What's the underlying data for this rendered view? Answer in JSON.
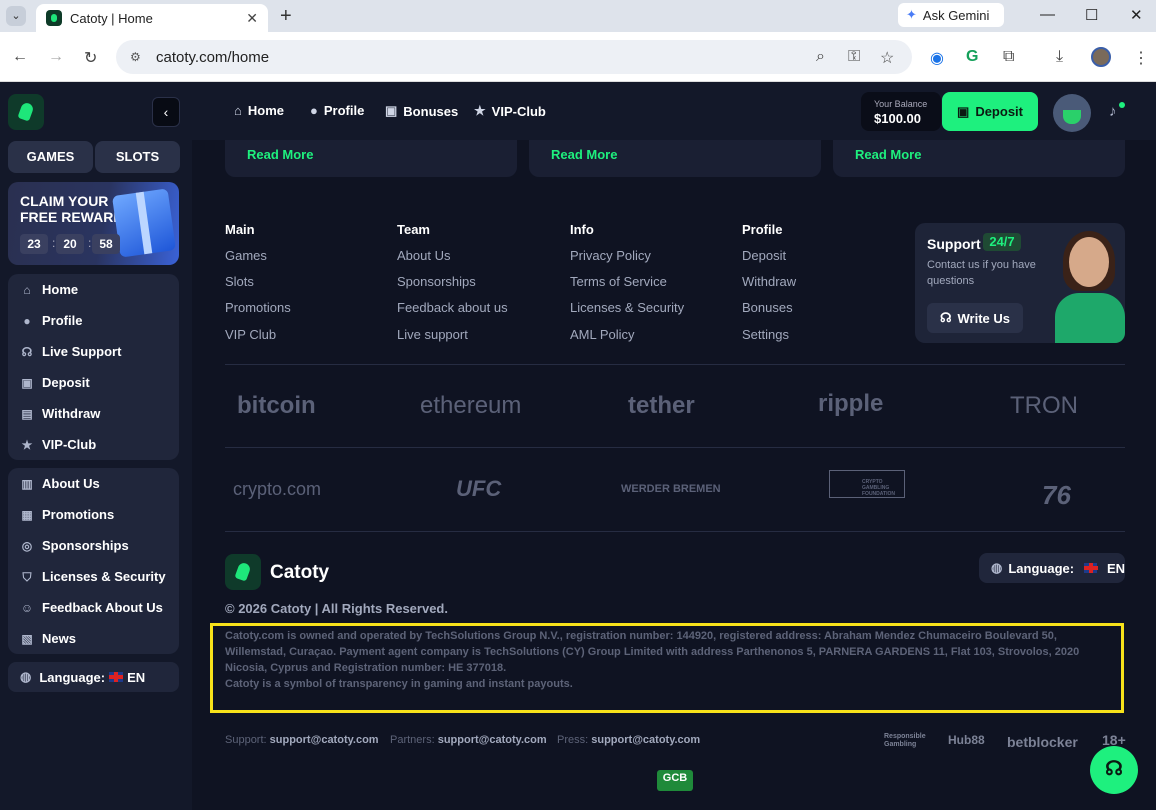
{
  "browser": {
    "tab_title": "Catoty | Home",
    "gemini": "Ask Gemini",
    "url": "catoty.com/home"
  },
  "sidebar": {
    "games_tab": "GAMES",
    "slots_tab": "SLOTS",
    "promo_title": "CLAIM YOUR FREE REWARD",
    "timer": [
      "23",
      "20",
      "58"
    ],
    "menu1": [
      {
        "label": "Home",
        "icon": "home-icon"
      },
      {
        "label": "Profile",
        "icon": "user-icon"
      },
      {
        "label": "Live Support",
        "icon": "headset-icon"
      },
      {
        "label": "Deposit",
        "icon": "wallet-icon"
      },
      {
        "label": "Withdraw",
        "icon": "withdraw-icon"
      },
      {
        "label": "VIP-Club",
        "icon": "star-icon"
      }
    ],
    "menu2": [
      {
        "label": "About Us",
        "icon": "book-icon"
      },
      {
        "label": "Promotions",
        "icon": "ticket-icon"
      },
      {
        "label": "Sponsorships",
        "icon": "medal-icon"
      },
      {
        "label": "Licenses & Security",
        "icon": "shield-icon"
      },
      {
        "label": "Feedback About Us",
        "icon": "feedback-icon"
      },
      {
        "label": "News",
        "icon": "news-icon"
      }
    ],
    "language_label": "Language:",
    "language_code": "EN"
  },
  "topnav": {
    "items": [
      "Home",
      "Profile",
      "Bonuses",
      "VIP-Club"
    ],
    "balance_label": "Your Balance",
    "balance_value": "$100.00",
    "deposit": "Deposit"
  },
  "cards": {
    "read_more": "Read More"
  },
  "footer": {
    "columns": [
      {
        "title": "Main",
        "links": [
          "Games",
          "Slots",
          "Promotions",
          "VIP Club"
        ]
      },
      {
        "title": "Team",
        "links": [
          "About Us",
          "Sponsorships",
          "Feedback about us",
          "Live support"
        ]
      },
      {
        "title": "Info",
        "links": [
          "Privacy Policy",
          "Terms of Service",
          "Licenses & Security",
          "AML Policy"
        ]
      },
      {
        "title": "Profile",
        "links": [
          "Deposit",
          "Withdraw",
          "Bonuses",
          "Settings"
        ]
      }
    ],
    "support_title": "Support",
    "support_badge": "24/7",
    "support_desc": "Contact us if you have questions",
    "write_us": "Write Us",
    "crypto_logos": [
      "bitcoin",
      "ethereum",
      "tether",
      "ripple",
      "TRON"
    ],
    "partner_logos": [
      "crypto.com",
      "UFC",
      "WERDER BREMEN",
      "CRYPTO GAMBLING FOUNDATION",
      "76"
    ],
    "brand_name": "Catoty",
    "language_label": "Language:",
    "language_code": "EN",
    "copyright": "© 2026 Catoty | All Rights Reserved.",
    "legal_1": "Catoty.com is owned and operated by TechSolutions Group N.V., registration number: 144920, registered address: Abraham Mendez Chumaceiro Boulevard 50, Willemstad, Curaçao. Payment agent company is TechSolutions (CY) Group Limited with address Parthenonos 5, PARNERA GARDENS 11, Flat 103, Strovolos, 2020 Nicosia, Cyprus and Registration number: HE 377018.",
    "legal_2": "Catoty is a symbol of transparency in gaming and instant payouts.",
    "contacts": [
      {
        "label": "Support:",
        "email": "support@catoty.com"
      },
      {
        "label": "Partners:",
        "email": "support@catoty.com"
      },
      {
        "label": "Press:",
        "email": "support@catoty.com"
      }
    ],
    "compliance": [
      "Responsible Gambling",
      "Hub88",
      "betblocker",
      "18+"
    ],
    "gcb": "GCB"
  },
  "colors": {
    "accent": "#1ef07e",
    "highlight": "#f7e21a",
    "bg": "#0f1322"
  }
}
